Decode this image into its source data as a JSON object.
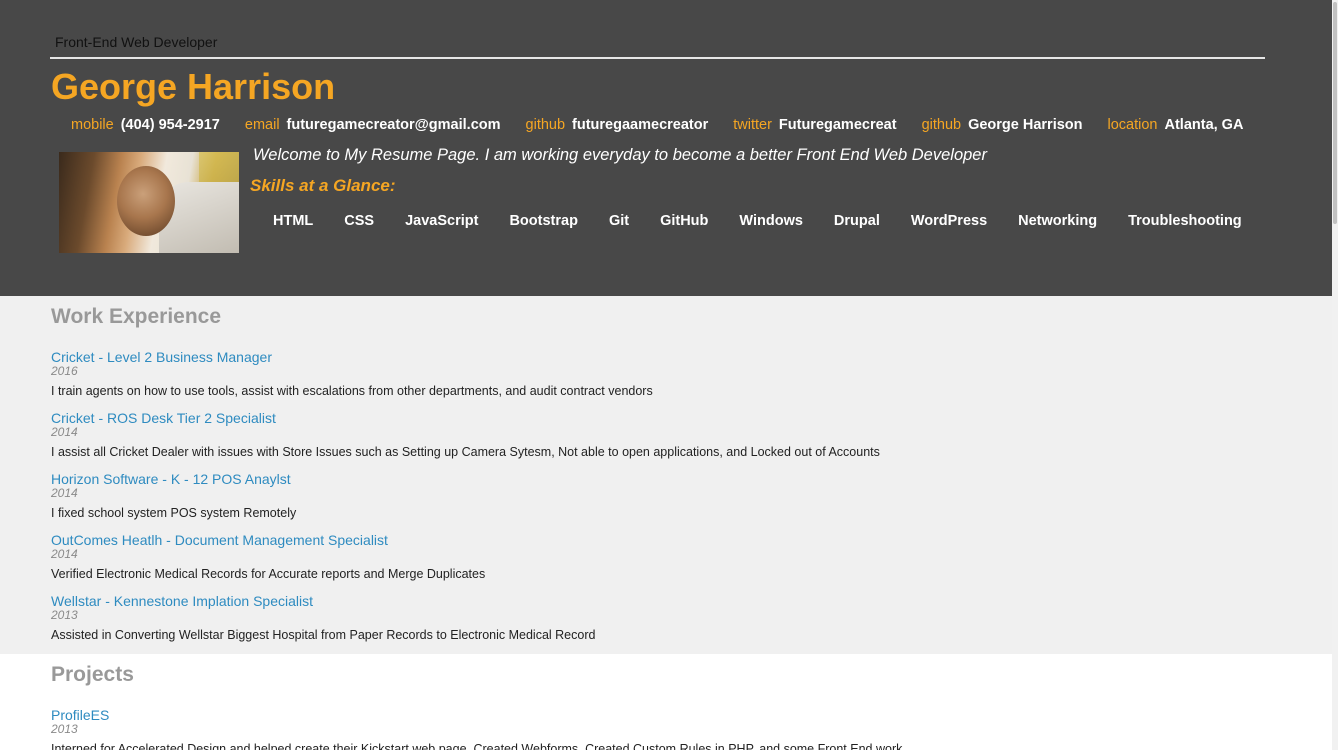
{
  "header": {
    "role": "Front-End Web Developer",
    "name": "George Harrison",
    "contacts": [
      {
        "label": "mobile",
        "value": "(404) 954-2917",
        "icon": "phone-icon"
      },
      {
        "label": "email",
        "value": "futuregamecreator@gmail.com",
        "icon": "email-icon"
      },
      {
        "label": "github",
        "value": "futuregaamecreator",
        "icon": "github-icon"
      },
      {
        "label": "twitter",
        "value": "Futuregamecreat",
        "icon": "twitter-icon"
      },
      {
        "label": "github",
        "value": "George Harrison",
        "icon": "github-icon"
      },
      {
        "label": "location",
        "value": "Atlanta, GA",
        "icon": "location-icon"
      }
    ],
    "welcome": "Welcome to My Resume Page. I am working everyday to become a better Front End Web Developer",
    "skills_title": "Skills at a Glance:",
    "skills": [
      "HTML",
      "CSS",
      "JavaScript",
      "Bootstrap",
      "Git",
      "GitHub",
      "Windows",
      "Drupal",
      "WordPress",
      "Networking",
      "Troubleshooting"
    ]
  },
  "work": {
    "title": "Work Experience",
    "jobs": [
      {
        "title": "Cricket - Level 2 Business Manager",
        "year": "2016",
        "desc": "I train agents on how to use tools, assist with escalations from other departments, and audit contract vendors"
      },
      {
        "title": "Cricket - ROS Desk Tier 2 Specialist",
        "year": "2014",
        "desc": "I assist all Cricket Dealer with issues with Store Issues such as Setting up Camera Sytesm, Not able to open applications, and Locked out of Accounts"
      },
      {
        "title": "Horizon Software - K - 12 POS Anaylst",
        "year": "2014",
        "desc": "I fixed school system POS system Remotely"
      },
      {
        "title": "OutComes Heatlh - Document Management Specialist",
        "year": "2014",
        "desc": "Verified Electronic Medical Records for Accurate reports and Merge Duplicates"
      },
      {
        "title": "Wellstar - Kennestone Implation Specialist",
        "year": "2013",
        "desc": "Assisted in Converting Wellstar Biggest Hospital from Paper Records to Electronic Medical Record"
      }
    ]
  },
  "projects": {
    "title": "Projects",
    "items": [
      {
        "title": "ProfileES",
        "year": "2013",
        "desc": "Interned for Accelerated Design and helped create their Kickstart web page, Created Webforms, Created Custom Rules in PHP, and some Front End work"
      }
    ]
  },
  "colors": {
    "header_bg": "#484848",
    "accent": "#f5a623",
    "link": "#2e8bc0",
    "section_title": "#999999",
    "work_bg": "#f0f0f0"
  }
}
